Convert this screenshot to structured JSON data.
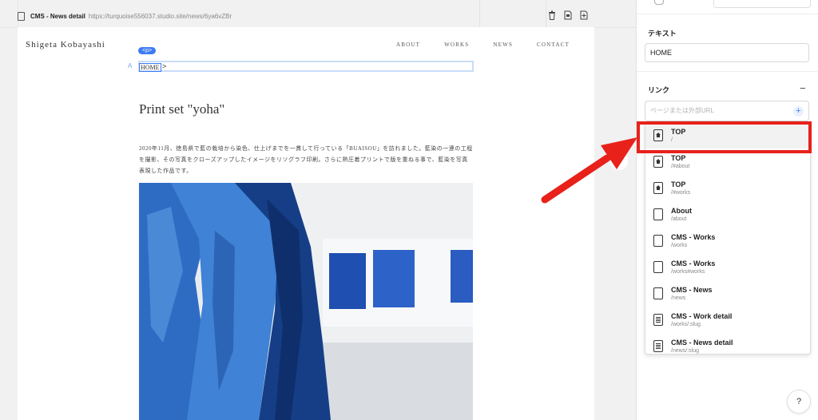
{
  "page_bar": {
    "page_name": "CMS - News detail",
    "url": "https://turquoise556037.studio.site/news/6ya6vZBr",
    "icons": [
      "trash-icon",
      "duplicate-page-icon",
      "add-page-icon"
    ]
  },
  "site": {
    "logo": "Shigeta Kobayashi",
    "nav": [
      "ABOUT",
      "WORKS",
      "NEWS",
      "CONTACT"
    ],
    "selection_badge": "<p>",
    "breadcrumb_home": "HOME",
    "breadcrumb_chevron": ">",
    "article_title": "Print set \"yoha\"",
    "article_body": "2020年11月、徳島県で藍の栽培から染色、仕上げまでを一貫して行っている「BUAISOU」を訪れました。藍染の一連の工程を撮影、その写真をクローズアップしたイメージをリソグラフ印刷。さらに熱圧着プリントで版を重ねる事で、藍染を写真表現した作品です。"
  },
  "panel": {
    "text_label": "テキスト",
    "text_value": "HOME",
    "link_label": "リンク",
    "link_collapse": "−",
    "link_placeholder": "ページまたは外部URL",
    "add_button": "+",
    "help_button": "?",
    "dropdown": [
      {
        "title": "TOP",
        "path": "/",
        "icon": "home"
      },
      {
        "title": "TOP",
        "path": "/#about",
        "icon": "home"
      },
      {
        "title": "TOP",
        "path": "/#works",
        "icon": "home"
      },
      {
        "title": "About",
        "path": "/about",
        "icon": "page"
      },
      {
        "title": "CMS - Works",
        "path": "/works",
        "icon": "page"
      },
      {
        "title": "CMS - Works",
        "path": "/works#works",
        "icon": "page"
      },
      {
        "title": "CMS - News",
        "path": "/news",
        "icon": "page"
      },
      {
        "title": "CMS - Work detail",
        "path": "/works/:slug",
        "icon": "doc"
      },
      {
        "title": "CMS - News detail",
        "path": "/news/:slug",
        "icon": "doc"
      }
    ]
  },
  "annotation": {
    "highlight_color": "#e8211b",
    "accent_color": "#3d7bf2"
  }
}
